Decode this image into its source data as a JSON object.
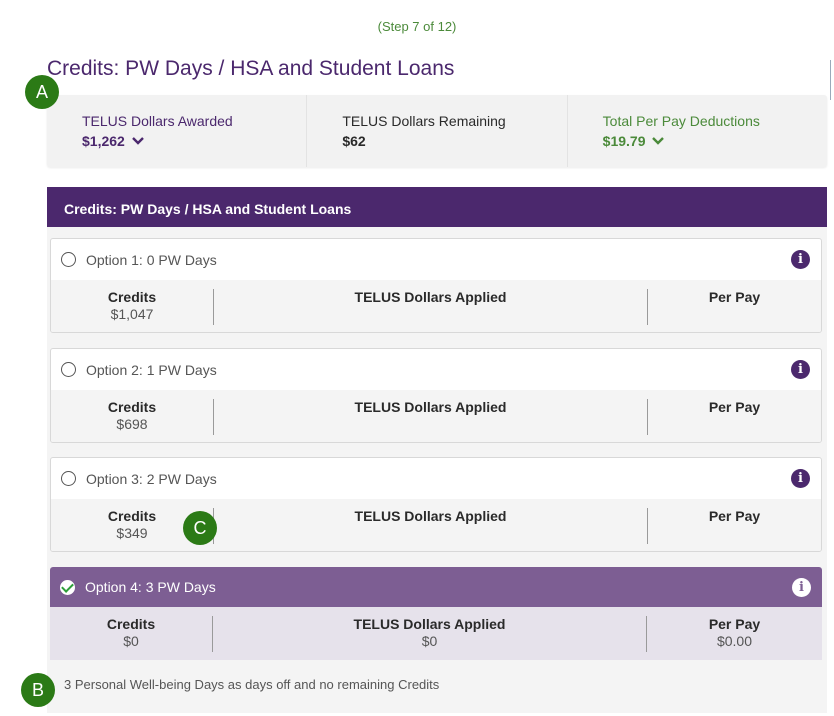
{
  "step": "(Step 7 of 12)",
  "page_title": "Credits: PW Days / HSA and Student Loans",
  "summary": {
    "awarded_label": "TELUS Dollars Awarded",
    "awarded_value": "$1,262",
    "remaining_label": "TELUS Dollars Remaining",
    "remaining_value": "$62",
    "total_label": "Total Per Pay Deductions",
    "total_value": "$19.79"
  },
  "panel": {
    "header": "Credits: PW Days / HSA and Student Loans",
    "columns": {
      "credits": "Credits",
      "applied": "TELUS Dollars Applied",
      "perpay": "Per Pay"
    },
    "options": [
      {
        "label": "Option 1: 0 PW Days",
        "credits": "$1,047",
        "applied": "",
        "perpay": "",
        "selected": false
      },
      {
        "label": "Option 2: 1 PW Days",
        "credits": "$698",
        "applied": "",
        "perpay": "",
        "selected": false
      },
      {
        "label": "Option 3: 2 PW Days",
        "credits": "$349",
        "applied": "",
        "perpay": "",
        "selected": false
      },
      {
        "label": "Option 4: 3 PW Days",
        "credits": "$0",
        "applied": "$0",
        "perpay": "$0.00",
        "selected": true,
        "description": "3 Personal Well-being Days as days off and no remaining Credits"
      }
    ]
  },
  "markers": {
    "a": "A",
    "b": "B",
    "c": "C"
  },
  "icons": {
    "info": "i",
    "chevron": "chevron-down-icon",
    "check": "check-icon"
  },
  "colors": {
    "brand_purple": "#4b286d",
    "selected_purple": "#7d5e93",
    "green": "#4b8a3a",
    "marker_green": "#2b7a16"
  }
}
